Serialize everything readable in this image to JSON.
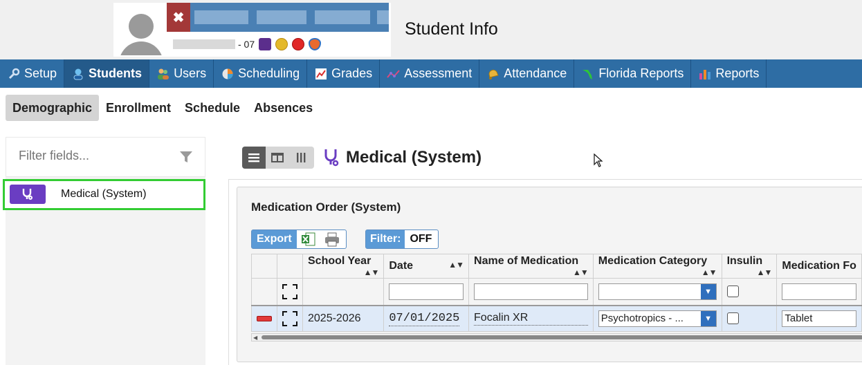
{
  "header": {
    "page_title": "Student Info",
    "student_id_suffix": "- 07",
    "close_label": "✖"
  },
  "nav": {
    "items": [
      {
        "label": "Setup",
        "icon": "wrench-icon"
      },
      {
        "label": "Students",
        "icon": "student-icon",
        "active": true
      },
      {
        "label": "Users",
        "icon": "users-icon"
      },
      {
        "label": "Scheduling",
        "icon": "scheduling-icon"
      },
      {
        "label": "Grades",
        "icon": "grades-icon"
      },
      {
        "label": "Assessment",
        "icon": "assessment-icon"
      },
      {
        "label": "Attendance",
        "icon": "bell-icon"
      },
      {
        "label": "Florida Reports",
        "icon": "florida-icon"
      },
      {
        "label": "Reports",
        "icon": "bar-chart-icon"
      }
    ]
  },
  "subtabs": {
    "items": [
      "Demographic",
      "Enrollment",
      "Schedule",
      "Absences"
    ],
    "active": "Demographic"
  },
  "sidebar": {
    "filter_placeholder": "Filter fields...",
    "field_label": "Medical (System)"
  },
  "main": {
    "section_title": "Medical (System)",
    "card_title": "Medication Order (System)",
    "export_label": "Export",
    "filter_label": "Filter:",
    "filter_value": "OFF",
    "columns": [
      "School Year",
      "Date",
      "Name of Medication",
      "Medication Category",
      "Insulin",
      "Medication Fo"
    ],
    "row": {
      "school_year": "2025-2026",
      "date": "07/01/2025",
      "medication": "Focalin XR",
      "category": "Psychotropics - ...",
      "form": "Tablet"
    }
  },
  "colors": {
    "nav_bg": "#2e6da4",
    "accent_purple": "#6a3dc2",
    "highlight_green": "#33cc33",
    "close_red": "#a33838"
  }
}
